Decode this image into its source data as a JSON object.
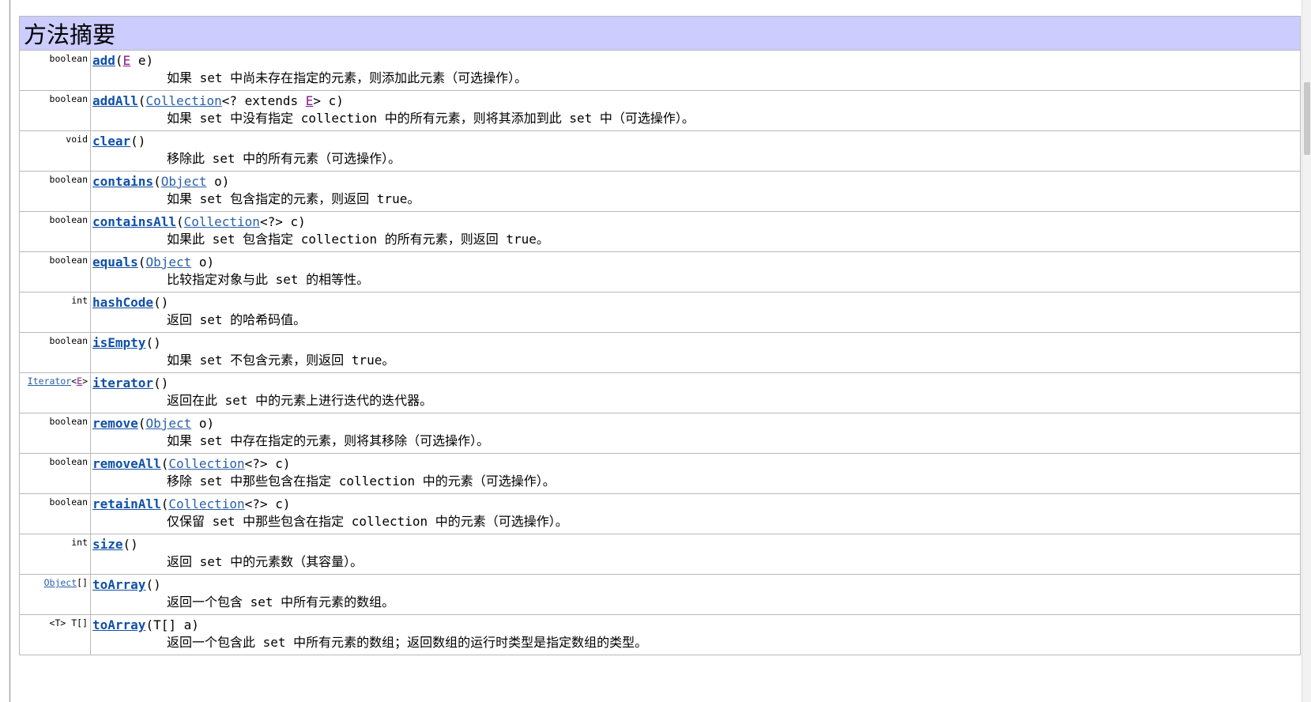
{
  "section": {
    "title": "方法摘要"
  },
  "methods": [
    {
      "type": [
        {
          "t": "boolean",
          "k": "plain"
        }
      ],
      "sig": [
        {
          "t": "add",
          "k": "method"
        },
        {
          "t": "(",
          "k": "plain"
        },
        {
          "t": "E",
          "k": "tparam"
        },
        {
          "t": " e)",
          "k": "plain"
        }
      ],
      "desc": "如果 set 中尚未存在指定的元素，则添加此元素（可选操作）。"
    },
    {
      "type": [
        {
          "t": "boolean",
          "k": "plain"
        }
      ],
      "sig": [
        {
          "t": "addAll",
          "k": "method"
        },
        {
          "t": "(",
          "k": "plain"
        },
        {
          "t": "Collection",
          "k": "type"
        },
        {
          "t": "<? extends ",
          "k": "plain"
        },
        {
          "t": "E",
          "k": "tparam"
        },
        {
          "t": "> c)",
          "k": "plain"
        }
      ],
      "desc": "如果 set 中没有指定 collection 中的所有元素，则将其添加到此 set 中（可选操作）。"
    },
    {
      "type": [
        {
          "t": "void",
          "k": "plain"
        }
      ],
      "sig": [
        {
          "t": "clear",
          "k": "method"
        },
        {
          "t": "()",
          "k": "plain"
        }
      ],
      "desc": "移除此 set 中的所有元素（可选操作）。"
    },
    {
      "type": [
        {
          "t": "boolean",
          "k": "plain"
        }
      ],
      "sig": [
        {
          "t": "contains",
          "k": "method"
        },
        {
          "t": "(",
          "k": "plain"
        },
        {
          "t": "Object",
          "k": "type"
        },
        {
          "t": " o)",
          "k": "plain"
        }
      ],
      "desc": "如果 set 包含指定的元素，则返回 true。"
    },
    {
      "type": [
        {
          "t": "boolean",
          "k": "plain"
        }
      ],
      "sig": [
        {
          "t": "containsAll",
          "k": "method"
        },
        {
          "t": "(",
          "k": "plain"
        },
        {
          "t": "Collection",
          "k": "type"
        },
        {
          "t": "<?> c)",
          "k": "plain"
        }
      ],
      "desc": "如果此 set 包含指定 collection 的所有元素，则返回 true。"
    },
    {
      "type": [
        {
          "t": "boolean",
          "k": "plain"
        }
      ],
      "sig": [
        {
          "t": "equals",
          "k": "method"
        },
        {
          "t": "(",
          "k": "plain"
        },
        {
          "t": "Object",
          "k": "type"
        },
        {
          "t": " o)",
          "k": "plain"
        }
      ],
      "desc": "比较指定对象与此 set 的相等性。"
    },
    {
      "type": [
        {
          "t": "int",
          "k": "plain"
        }
      ],
      "sig": [
        {
          "t": "hashCode",
          "k": "method"
        },
        {
          "t": "()",
          "k": "plain"
        }
      ],
      "desc": "返回 set 的哈希码值。"
    },
    {
      "type": [
        {
          "t": "boolean",
          "k": "plain"
        }
      ],
      "sig": [
        {
          "t": "isEmpty",
          "k": "method"
        },
        {
          "t": "()",
          "k": "plain"
        }
      ],
      "desc": "如果 set 不包含元素，则返回 true。"
    },
    {
      "type": [
        {
          "t": "Iterator",
          "k": "type"
        },
        {
          "t": "<",
          "k": "plain"
        },
        {
          "t": "E",
          "k": "tparam"
        },
        {
          "t": ">",
          "k": "plain"
        }
      ],
      "sig": [
        {
          "t": "iterator",
          "k": "method"
        },
        {
          "t": "()",
          "k": "plain"
        }
      ],
      "desc": "返回在此 set 中的元素上进行迭代的迭代器。"
    },
    {
      "type": [
        {
          "t": "boolean",
          "k": "plain"
        }
      ],
      "sig": [
        {
          "t": "remove",
          "k": "method"
        },
        {
          "t": "(",
          "k": "plain"
        },
        {
          "t": "Object",
          "k": "type"
        },
        {
          "t": " o)",
          "k": "plain"
        }
      ],
      "desc": "如果 set 中存在指定的元素，则将其移除（可选操作）。"
    },
    {
      "type": [
        {
          "t": "boolean",
          "k": "plain"
        }
      ],
      "sig": [
        {
          "t": "removeAll",
          "k": "method"
        },
        {
          "t": "(",
          "k": "plain"
        },
        {
          "t": "Collection",
          "k": "type"
        },
        {
          "t": "<?> c)",
          "k": "plain"
        }
      ],
      "desc": "移除 set 中那些包含在指定 collection 中的元素（可选操作）。"
    },
    {
      "type": [
        {
          "t": "boolean",
          "k": "plain"
        }
      ],
      "sig": [
        {
          "t": "retainAll",
          "k": "method"
        },
        {
          "t": "(",
          "k": "plain"
        },
        {
          "t": "Collection",
          "k": "type"
        },
        {
          "t": "<?> c)",
          "k": "plain"
        }
      ],
      "desc": "仅保留 set 中那些包含在指定 collection 中的元素（可选操作）。"
    },
    {
      "type": [
        {
          "t": "int",
          "k": "plain"
        }
      ],
      "sig": [
        {
          "t": "size",
          "k": "method"
        },
        {
          "t": "()",
          "k": "plain"
        }
      ],
      "desc": "返回 set 中的元素数（其容量）。"
    },
    {
      "type": [
        {
          "t": "Object",
          "k": "type"
        },
        {
          "t": "[]",
          "k": "plain"
        }
      ],
      "sig": [
        {
          "t": "toArray",
          "k": "method"
        },
        {
          "t": "()",
          "k": "plain"
        }
      ],
      "desc": "返回一个包含 set 中所有元素的数组。"
    },
    {
      "type": [
        {
          "t": "<T> T[]",
          "k": "plain"
        }
      ],
      "sig": [
        {
          "t": "toArray",
          "k": "method"
        },
        {
          "t": "(T[] a)",
          "k": "plain"
        }
      ],
      "desc": "返回一个包含此 set 中所有元素的数组；返回数组的运行时类型是指定数组的类型。"
    }
  ],
  "colors": {
    "header_bg": "#ccccff",
    "link": "#1050a8",
    "type_param": "#8a1a8a"
  }
}
